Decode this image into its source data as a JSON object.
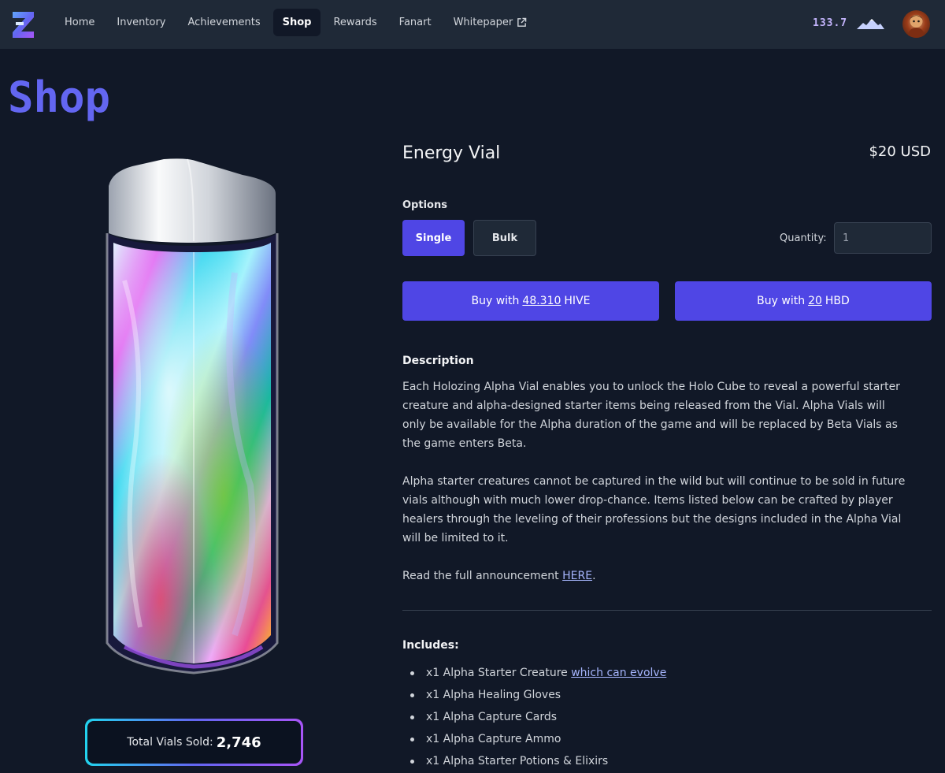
{
  "nav": {
    "items": [
      {
        "label": "Home"
      },
      {
        "label": "Inventory"
      },
      {
        "label": "Achievements"
      },
      {
        "label": "Shop",
        "active": true
      },
      {
        "label": "Rewards"
      },
      {
        "label": "Fanart"
      },
      {
        "label": "Whitepaper",
        "external": true
      }
    ],
    "balance": "133.7",
    "balance_icon": "mountain-icon",
    "avatar_icon": "user-avatar"
  },
  "page": {
    "title": "Shop"
  },
  "product": {
    "name": "Energy Vial",
    "price": "$20 USD",
    "options_label": "Options",
    "options": [
      {
        "label": "Single",
        "selected": true
      },
      {
        "label": "Bulk",
        "selected": false
      }
    ],
    "quantity_label": "Quantity:",
    "quantity_value": "1",
    "buy_hive": {
      "prefix": "Buy with",
      "amount": "48.310",
      "currency": "HIVE"
    },
    "buy_hbd": {
      "prefix": "Buy with",
      "amount": "20",
      "currency": "HBD"
    },
    "sold_label": "Total Vials Sold:",
    "sold_count": "2,746"
  },
  "description": {
    "title": "Description",
    "p1": "Each Holozing Alpha Vial enables you to unlock the Holo Cube to reveal a powerful starter creature and alpha-designed starter items being released from the Vial. Alpha Vials will only be available for the Alpha duration of the game and will be replaced by Beta Vials as the game enters Beta.",
    "p2": "Alpha starter creatures cannot be captured in the wild but will continue to be sold in future vials although with much lower drop-chance. Items listed below can be crafted by player healers through the leveling of their professions but the designs included in the Alpha Vial will be limited to it.",
    "p3_prefix": "Read the full announcement ",
    "p3_link": "HERE",
    "p3_suffix": "."
  },
  "includes": {
    "title": "Includes:",
    "item1_prefix": "x1 Alpha Starter Creature ",
    "item1_link": "which can evolve",
    "items": [
      "x1 Alpha Healing Gloves",
      "x1 Alpha Capture Cards",
      "x1 Alpha Capture Ammo",
      "x1 Alpha Starter Potions & Elixirs"
    ]
  },
  "colors": {
    "background": "#111827",
    "nav_bg": "#1f2937",
    "accent": "#4f46e5",
    "title": "#6366f1"
  }
}
